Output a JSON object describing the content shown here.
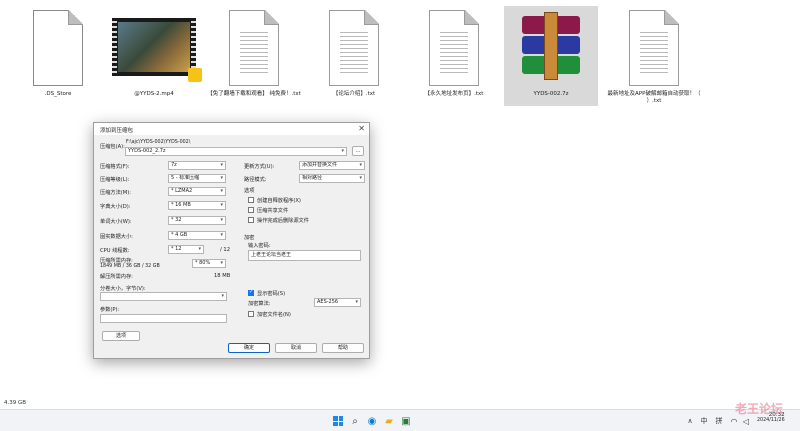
{
  "files": [
    {
      "name": ".DS_Store",
      "type": "blank"
    },
    {
      "name": "@YYDS-2.mp4",
      "type": "video"
    },
    {
      "name": "【免了翻墙下载和观看】 纯免费！.txt",
      "type": "doc"
    },
    {
      "name": "【论坛介绍】.txt",
      "type": "doc"
    },
    {
      "name": "【永久地址发布页】.txt",
      "type": "doc"
    },
    {
      "name": "YYDS-002.7z",
      "type": "archive"
    },
    {
      "name": "最新地址及APP破解邮箱自动获取！（ ）.txt",
      "type": "doc"
    }
  ],
  "status": {
    "size": "4.39 GB"
  },
  "dialog": {
    "title": "添加到压缩包",
    "archive_label": "压缩包(A):",
    "archive_path": "F:\\ajc\\YYDS-002\\YYDS-002\\",
    "archive_name": "YYDS-002_2.7z",
    "browse": "...",
    "format_label": "压缩格式(F):",
    "format_value": "7z",
    "level_label": "压缩等级(L):",
    "level_value": "5 - 标准压缩",
    "method_label": "压缩方法(M):",
    "method_value": "* LZMA2",
    "dict_label": "字典大小(D):",
    "dict_value": "* 16 MB",
    "word_label": "单词大小(W):",
    "word_value": "* 32",
    "solid_label": "固实数据大小:",
    "solid_value": "* 4 GB",
    "cpu_label": "CPU 线程数:",
    "cpu_value": "* 12",
    "cpu_total": "/ 12",
    "mem_comp_label": "压缩所需内存:",
    "mem_comp_value": "1849 MB / 36 GB / 32 GB",
    "mem_percent": "* 80%",
    "mem_decomp_label": "解压所需内存:",
    "mem_decomp_value": "18 MB",
    "split_label": "分卷大小，字节(V):",
    "params_label": "参数(P):",
    "options_btn": "选项",
    "update_label": "更新方式(U):",
    "update_value": "添加并替换文件",
    "pathmode_label": "路径模式:",
    "pathmode_value": "相对路径",
    "options_group": "选项",
    "opt_sfx": "创建自释放程序(X)",
    "opt_shared": "压缩共享文件",
    "opt_delete": "操作完成后删除源文件",
    "encrypt_group": "加密",
    "password_label": "输入密码:",
    "password_value": "上老王论坛当老王",
    "show_password": "显示密码(S)",
    "enc_method_label": "加密算法:",
    "enc_method_value": "AES-256",
    "encrypt_names": "加密文件名(N)",
    "ok": "确定",
    "cancel": "取消",
    "help": "帮助"
  },
  "taskbar": {
    "ime_lang": "中",
    "ime_mode": "拼",
    "time": "20:32",
    "date": "2024/11/26"
  },
  "watermark": "老王论坛"
}
